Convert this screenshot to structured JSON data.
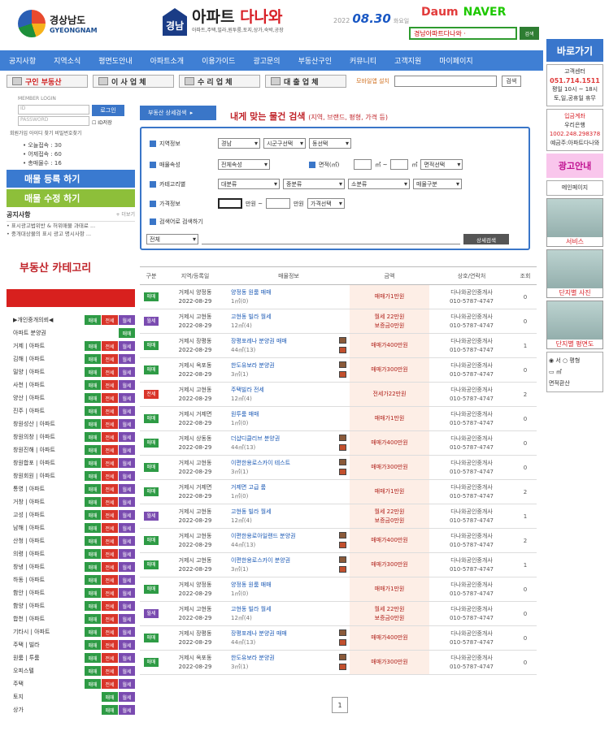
{
  "header": {
    "logo_kr": "경상남도",
    "logo_en": "GYEONGNAM",
    "badge": "경남",
    "site_name_a": "아파트",
    "site_name_b": "다나와",
    "site_sub": "아파트,주택,빌라,원투룸,토지,상가,숙박,공장",
    "date_year": "2022",
    "date_md": "08.30",
    "date_wd": "화요일",
    "partner_daum": "Daum",
    "partner_naver": "NAVER",
    "search_value": "경남아파트다나와 ·",
    "search_btn": "검색"
  },
  "nav": [
    "공지사항",
    "지역소식",
    "평면도안내",
    "아파트소개",
    "이용가이드",
    "광고문의",
    "부동산구인",
    "커뮤니티",
    "고객지원",
    "마이페이지"
  ],
  "catbar": {
    "buttons": [
      "구인 부동산",
      "이 사 업 체",
      "수 리 업 체",
      "대 출 업 체"
    ],
    "mobile_note": "모바일앱 설치",
    "btn": "검색"
  },
  "right": {
    "title": "바로가기",
    "box1": "고객센터",
    "phone": "051.714.1511",
    "hours": "평일 10시 ~ 18시",
    "closed": "토,일,공휴일 휴무",
    "box2_title": "입금계좌",
    "bank": "우리은행",
    "account": "1002.248.298378",
    "holder": "예금주:아파트다나와",
    "ad_guide": "광고안내",
    "main_page": "메인페이지",
    "service": "서비스",
    "photo": "단지별 사진",
    "floorplan": "단지별 평면도",
    "radio_a": "서",
    "radio_b": "평형",
    "radio_c": "㎡",
    "confirm": "면적환산"
  },
  "left": {
    "login_title": "MEMBER LOGIN",
    "id_ph": "ID",
    "pw_ph": "PASSWORD",
    "login_btn": "로그인",
    "remember": "ID저장",
    "links": "회원가입   아이디 찾기   비밀번호찾기",
    "stats": [
      "오늘접속 : 30",
      "어제접속 : 60",
      "총매물수 : 16"
    ],
    "reg_btn": "매물 등록 하기",
    "mod_btn": "매물 수정 하기",
    "notice_title": "공지사항",
    "more": "+ 더보기",
    "notices": [
      "표시광고법위반 & 허위매물 과태료 ...",
      "중개대상물의 표시 광고 명시사항 ..."
    ],
    "cat_title": "부동산 카테고리",
    "categories": [
      {
        "name": "▶개인중개의뢰◀",
        "tags": [
          "g",
          "r",
          "p"
        ]
      },
      {
        "name": "아파트 분양권",
        "tags": [
          "g"
        ]
      },
      {
        "name": "거제 | 아파트",
        "tags": [
          "g",
          "r",
          "p"
        ]
      },
      {
        "name": "김해 | 아파트",
        "tags": [
          "g",
          "r",
          "p"
        ]
      },
      {
        "name": "밀양 | 아파트",
        "tags": [
          "g",
          "r",
          "p"
        ]
      },
      {
        "name": "사천 | 아파트",
        "tags": [
          "g",
          "r",
          "p"
        ]
      },
      {
        "name": "양산 | 아파트",
        "tags": [
          "g",
          "r",
          "p"
        ]
      },
      {
        "name": "진주 | 아파트",
        "tags": [
          "g",
          "r",
          "p"
        ]
      },
      {
        "name": "창원성산 | 아파트",
        "tags": [
          "g",
          "r",
          "p"
        ]
      },
      {
        "name": "창원의창 | 아파트",
        "tags": [
          "g",
          "r",
          "p"
        ]
      },
      {
        "name": "창원진해 | 아파트",
        "tags": [
          "g",
          "r",
          "p"
        ]
      },
      {
        "name": "창원합포 | 아파트",
        "tags": [
          "g",
          "r",
          "p"
        ]
      },
      {
        "name": "창원회원 | 아파트",
        "tags": [
          "g",
          "r",
          "p"
        ]
      },
      {
        "name": "통영 | 아파트",
        "tags": [
          "g",
          "r",
          "p"
        ]
      },
      {
        "name": "거창 | 아파트",
        "tags": [
          "g",
          "r",
          "p"
        ]
      },
      {
        "name": "고성 | 아파트",
        "tags": [
          "g",
          "r",
          "p"
        ]
      },
      {
        "name": "남해 | 아파트",
        "tags": [
          "g",
          "r",
          "p"
        ]
      },
      {
        "name": "산청 | 아파트",
        "tags": [
          "g",
          "r",
          "p"
        ]
      },
      {
        "name": "의령 | 아파트",
        "tags": [
          "g",
          "r",
          "p"
        ]
      },
      {
        "name": "창녕 | 아파트",
        "tags": [
          "g",
          "r",
          "p"
        ]
      },
      {
        "name": "하동 | 아파트",
        "tags": [
          "g",
          "r",
          "p"
        ]
      },
      {
        "name": "함안 | 아파트",
        "tags": [
          "g",
          "r",
          "p"
        ]
      },
      {
        "name": "함양 | 아파트",
        "tags": [
          "g",
          "r",
          "p"
        ]
      },
      {
        "name": "합천 | 아파트",
        "tags": [
          "g",
          "r",
          "p"
        ]
      },
      {
        "name": "기타시 | 아파트",
        "tags": [
          "g",
          "r",
          "p"
        ]
      },
      {
        "name": "주택 | 빌라",
        "tags": [
          "g",
          "r",
          "p"
        ]
      },
      {
        "name": "원룸 | 투룸",
        "tags": [
          "g",
          "r",
          "p"
        ]
      },
      {
        "name": "오피스텔",
        "tags": [
          "g",
          "r",
          "p"
        ]
      },
      {
        "name": "주택",
        "tags": [
          "g",
          "r",
          "p"
        ]
      },
      {
        "name": "토지",
        "tags": [
          "g",
          "p"
        ]
      },
      {
        "name": "상가",
        "tags": [
          "g",
          "p"
        ]
      }
    ],
    "tag_labels": {
      "g": "매매",
      "r": "전세",
      "p": "월세"
    }
  },
  "search": {
    "tab": "부동산 상세검색",
    "title": "내게 맞는 물건 검색",
    "title_sub": "(지역, 브랜드, 평형, 가격 등)",
    "region_label": "지역정보",
    "region": [
      "경남",
      "시군구선택",
      "동선택"
    ],
    "type_label": "매물속성",
    "type": "전체속성",
    "area_label": "면적(㎡)",
    "area_unit": "㎡ ~",
    "area_unit2": "㎡",
    "area_sel": "면적선택",
    "cat_label": "카테고리별",
    "cats": [
      "대분류",
      "중분류",
      "소분류",
      "매물구분"
    ],
    "price_label": "가격정보",
    "price_unit": "만원 ~",
    "price_unit2": "만원",
    "price_sel": "가격선택",
    "keyword_label": "검색어로 검색하기",
    "keyword_sel": "전체",
    "search_btn": "상세검색"
  },
  "table": {
    "headers": [
      "구분",
      "지역/등록일",
      "매물정보",
      "금액",
      "상호/연락처",
      "조회"
    ],
    "rows": [
      {
        "tag": "매매",
        "c": "g",
        "loc": "거제시 양정동",
        "date": "2022-08-29",
        "title": "양정동 원룸 매매",
        "spec": "1㎡(0)",
        "price": "매매가1만원",
        "price2": "",
        "agent": "다나와공인중개사",
        "tel": "010-5787-4747",
        "views": "0",
        "pic": false
      },
      {
        "tag": "월세",
        "c": "p",
        "loc": "거제시 고현동",
        "date": "2022-08-29",
        "title": "고현동 빌라 월세",
        "spec": "12㎡(4)",
        "price": "월세 22만원",
        "price2": "보증금0만원",
        "agent": "다나와공인중개사",
        "tel": "010-5787-4747",
        "views": "0",
        "pic": false
      },
      {
        "tag": "매매",
        "c": "g",
        "loc": "거제시 장평동",
        "date": "2022-08-29",
        "title": "장평포레나 분양권 매매",
        "spec": "44㎡(13)",
        "price": "매매가400만원",
        "price2": "",
        "agent": "다나와공인중개사",
        "tel": "010-5787-4747",
        "views": "1",
        "pic": true
      },
      {
        "tag": "매매",
        "c": "g",
        "loc": "거제시 옥포동",
        "date": "2022-08-29",
        "title": "한도유보라 분양권",
        "spec": "3㎡(1)",
        "price": "매매가300만원",
        "price2": "",
        "agent": "다나와공인중개사",
        "tel": "010-5787-4747",
        "views": "0",
        "pic": true
      },
      {
        "tag": "전세",
        "c": "r",
        "loc": "거제시 고현동",
        "date": "2022-08-29",
        "title": "주택빌라 전세",
        "spec": "12㎡(4)",
        "price": "전세가22만원",
        "price2": "",
        "agent": "다나와공인중개사",
        "tel": "010-5787-4747",
        "views": "2",
        "pic": false
      },
      {
        "tag": "매매",
        "c": "g",
        "loc": "거제시 거제면",
        "date": "2022-08-29",
        "title": "원투룸 매매",
        "spec": "1㎡(0)",
        "price": "매매가1만원",
        "price2": "",
        "agent": "다나와공인중개사",
        "tel": "010-5787-4747",
        "views": "0",
        "pic": false
      },
      {
        "tag": "매매",
        "c": "g",
        "loc": "거제시 상동동",
        "date": "2022-08-29",
        "title": "더샵디클리브 분양권",
        "spec": "44㎡(13)",
        "price": "매매가400만원",
        "price2": "",
        "agent": "다나와공인중개사",
        "tel": "010-5787-4747",
        "views": "0",
        "pic": true
      },
      {
        "tag": "매매",
        "c": "g",
        "loc": "거제시 고현동",
        "date": "2022-08-29",
        "title": "이편한용로스카이 테스트",
        "spec": "3㎡(1)",
        "price": "매매가300만원",
        "price2": "",
        "agent": "다나와공인중개사",
        "tel": "010-5787-4747",
        "views": "0",
        "pic": true
      },
      {
        "tag": "매매",
        "c": "g",
        "loc": "거제시 거제면",
        "date": "2022-08-29",
        "title": "거제면 고급 룸",
        "spec": "1㎡(0)",
        "price": "매매가1만원",
        "price2": "",
        "agent": "다나와공인중개사",
        "tel": "010-5787-4747",
        "views": "2",
        "pic": false
      },
      {
        "tag": "월세",
        "c": "p",
        "loc": "거제시 고현동",
        "date": "2022-08-29",
        "title": "고현동 빌라 월세",
        "spec": "12㎡(4)",
        "price": "월세 22만원",
        "price2": "보증금0만원",
        "agent": "다나와공인중개사",
        "tel": "010-5787-4747",
        "views": "1",
        "pic": false
      },
      {
        "tag": "매매",
        "c": "g",
        "loc": "거제시 고현동",
        "date": "2022-08-29",
        "title": "이편한용로아일랜드 분양권",
        "spec": "44㎡(13)",
        "price": "매매가400만원",
        "price2": "",
        "agent": "다나와공인중개사",
        "tel": "010-5787-4747",
        "views": "2",
        "pic": true
      },
      {
        "tag": "매매",
        "c": "g",
        "loc": "거제시 고현동",
        "date": "2022-08-29",
        "title": "이편한용로스카이 분양권",
        "spec": "3㎡(1)",
        "price": "매매가300만원",
        "price2": "",
        "agent": "다나와공인중개사",
        "tel": "010-5787-4747",
        "views": "1",
        "pic": true
      },
      {
        "tag": "매매",
        "c": "g",
        "loc": "거제시 양정동",
        "date": "2022-08-29",
        "title": "양정동 원룸 매매",
        "spec": "1㎡(0)",
        "price": "매매가1만원",
        "price2": "",
        "agent": "다나와공인중개사",
        "tel": "010-5787-4747",
        "views": "0",
        "pic": false
      },
      {
        "tag": "월세",
        "c": "p",
        "loc": "거제시 고현동",
        "date": "2022-08-29",
        "title": "고현동 빌라 월세",
        "spec": "12㎡(4)",
        "price": "월세 22만원",
        "price2": "보증금0만원",
        "agent": "다나와공인중개사",
        "tel": "010-5787-4747",
        "views": "0",
        "pic": false
      },
      {
        "tag": "매매",
        "c": "g",
        "loc": "거제시 장평동",
        "date": "2022-08-29",
        "title": "장평포레나 분양권 매매",
        "spec": "44㎡(13)",
        "price": "매매가400만원",
        "price2": "",
        "agent": "다나와공인중개사",
        "tel": "010-5787-4747",
        "views": "0",
        "pic": true
      },
      {
        "tag": "매매",
        "c": "g",
        "loc": "거제시 옥포동",
        "date": "2022-08-29",
        "title": "한도유보라 분양권",
        "spec": "3㎡(1)",
        "price": "매매가300만원",
        "price2": "",
        "agent": "다나와공인중개사",
        "tel": "010-5787-4747",
        "views": "0",
        "pic": true
      }
    ]
  },
  "pager": {
    "current": "1"
  }
}
